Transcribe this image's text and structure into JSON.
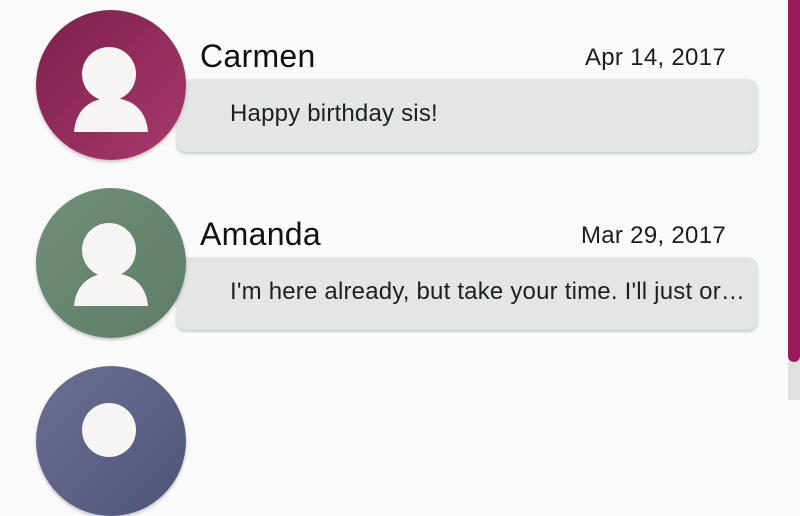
{
  "conversations": [
    {
      "name": "Carmen",
      "date": "Apr 14, 2017",
      "preview": "Happy birthday sis!",
      "avatar_icon": "person-icon",
      "avatar_color_light": "#a73a6c",
      "avatar_color_dark": "#7d1f4b"
    },
    {
      "name": "Amanda",
      "date": "Mar 29, 2017",
      "preview": "I'm here already, but take your time. I'll just ord…",
      "avatar_icon": "person-icon",
      "avatar_color_light": "#7c9b85",
      "avatar_color_dark": "#5e7d68"
    },
    {
      "name": "",
      "date": "",
      "preview": "",
      "avatar_icon": "person-icon",
      "avatar_color_light": "#6b6f92",
      "avatar_color_dark": "#4f5479"
    }
  ],
  "theme": {
    "scroll_thumb_color": "#9b1a5b",
    "bubble_color": "#e4e5e5"
  }
}
